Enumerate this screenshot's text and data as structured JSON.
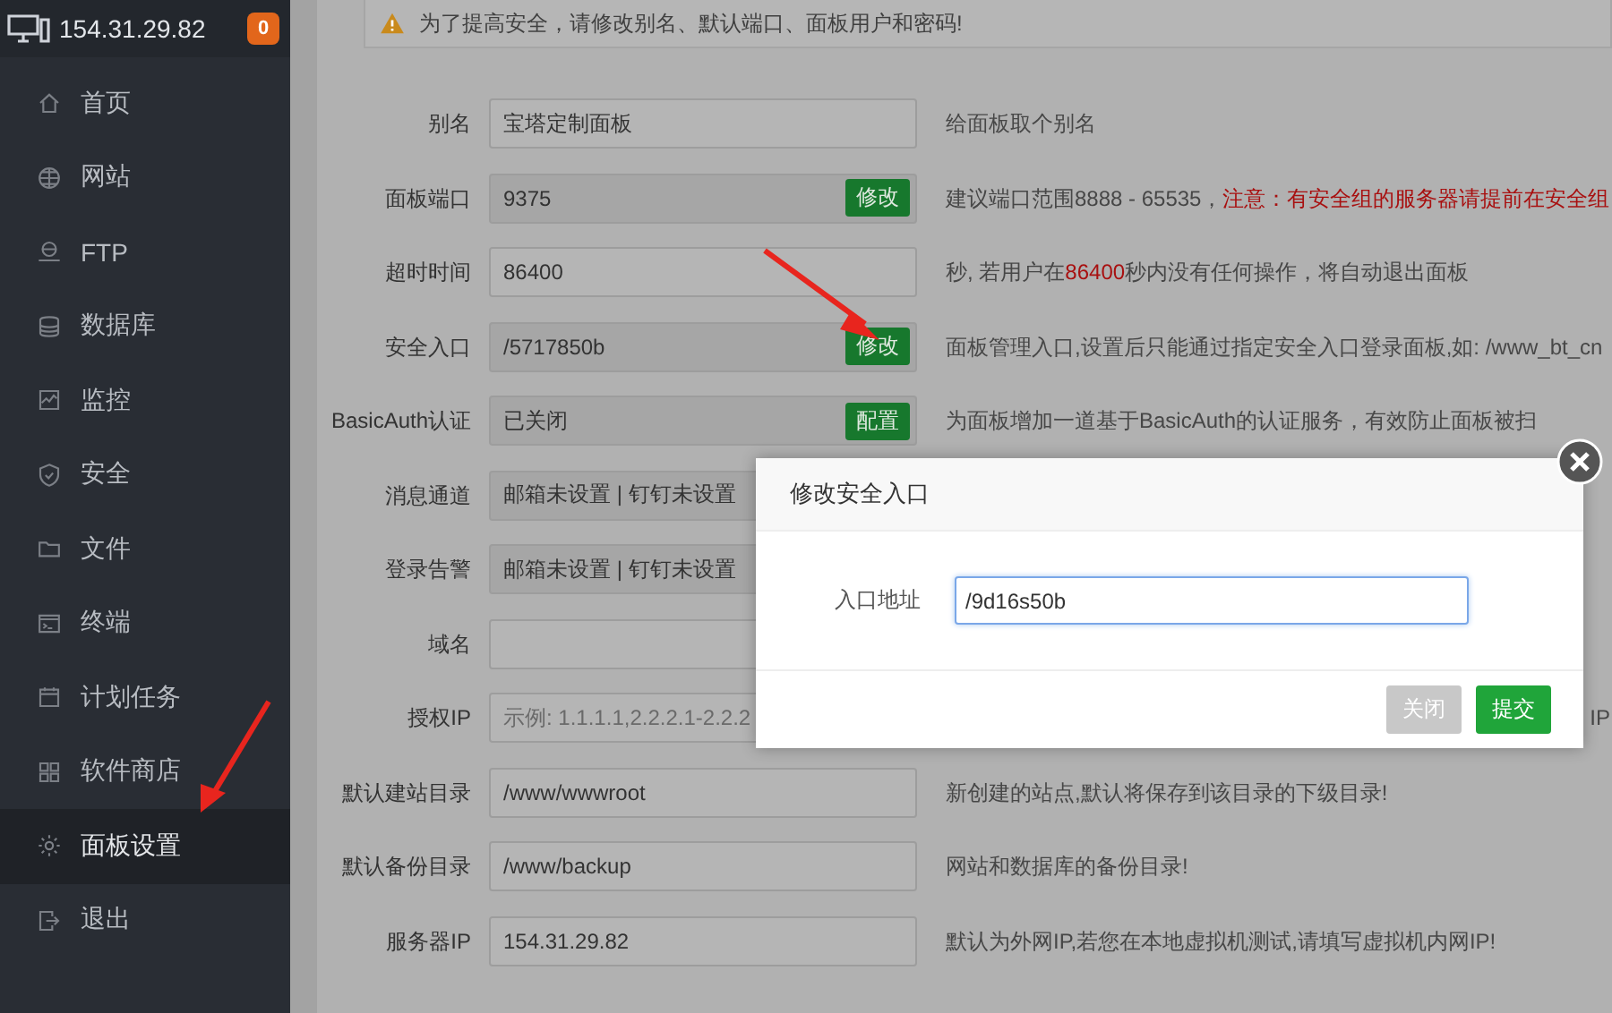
{
  "sidebar": {
    "server": "154.31.29.82",
    "badge": "0",
    "items": [
      {
        "label": "首页",
        "selected": false
      },
      {
        "label": "网站",
        "selected": false
      },
      {
        "label": "FTP",
        "selected": false
      },
      {
        "label": "数据库",
        "selected": false
      },
      {
        "label": "监控",
        "selected": false
      },
      {
        "label": "安全",
        "selected": false
      },
      {
        "label": "文件",
        "selected": false
      },
      {
        "label": "终端",
        "selected": false
      },
      {
        "label": "计划任务",
        "selected": false
      },
      {
        "label": "软件商店",
        "selected": false
      },
      {
        "label": "面板设置",
        "selected": true
      },
      {
        "label": "退出",
        "selected": false
      }
    ]
  },
  "warning": "为了提高安全，请修改别名、默认端口、面板用户和密码!",
  "form": [
    {
      "label": "别名",
      "value": "宝塔定制面板",
      "disabled": false,
      "hint": [
        {
          "text": "给面板取个别名",
          "kind": "plain"
        }
      ]
    },
    {
      "label": "面板端口",
      "value": "9375",
      "disabled": true,
      "button": "修改",
      "hint": [
        {
          "text": "建议端口范围8888 - 65535，",
          "kind": "plain"
        },
        {
          "text": "注意：有安全组的服务器请提前在安全组",
          "kind": "warn"
        }
      ]
    },
    {
      "label": "超时时间",
      "value": "86400",
      "disabled": false,
      "hint": [
        {
          "text": "秒, 若用户在",
          "kind": "plain"
        },
        {
          "text": "86400",
          "kind": "warn"
        },
        {
          "text": "秒内没有任何操作，将自动退出面板",
          "kind": "plain"
        }
      ]
    },
    {
      "label": "安全入口",
      "value": "/5717850b",
      "disabled": true,
      "button": "修改",
      "hint": [
        {
          "text": "面板管理入口,设置后只能通过指定安全入口登录面板,如: /www_bt_cn",
          "kind": "plain"
        }
      ]
    },
    {
      "label": "BasicAuth认证",
      "value": "已关闭",
      "disabled": true,
      "button": "配置",
      "hint": [
        {
          "text": "为面板增加一道基于BasicAuth的认证服务，有效防止面板被扫",
          "kind": "plain"
        }
      ]
    },
    {
      "label": "消息通道",
      "value": "邮箱未设置 | 钉钉未设置",
      "disabled": true
    },
    {
      "label": "登录告警",
      "value": "邮箱未设置 | 钉钉未设置",
      "disabled": true
    },
    {
      "label": "域名",
      "disabled": false
    },
    {
      "label": "授权IP",
      "placeholder": "示例: 1.1.1.1,2.2.2.1-2.2.2",
      "disabled": false,
      "hint_end": "IP"
    },
    {
      "label": "默认建站目录",
      "value": "/www/wwwroot",
      "disabled": false,
      "hint": [
        {
          "text": "新创建的站点,默认将保存到该目录的下级目录!",
          "kind": "plain"
        }
      ]
    },
    {
      "label": "默认备份目录",
      "value": "/www/backup",
      "disabled": false,
      "hint": [
        {
          "text": "网站和数据库的备份目录!",
          "kind": "plain"
        }
      ]
    },
    {
      "label": "服务器IP",
      "value": "154.31.29.82",
      "disabled": false,
      "hint": [
        {
          "text": "默认为外网IP,若您在本地虚拟机测试,请填写虚拟机内网IP!",
          "kind": "plain"
        }
      ]
    }
  ],
  "dialog": {
    "title": "修改安全入口",
    "field_label": "入口地址",
    "value": "/9d16s50b",
    "buttons": [
      {
        "label": "关闭",
        "kind": "cancel"
      },
      {
        "label": "提交",
        "kind": "primary"
      }
    ]
  }
}
